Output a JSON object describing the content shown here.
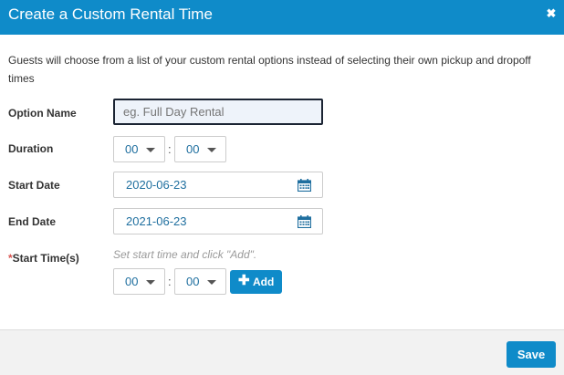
{
  "modal": {
    "title": "Create a Custom Rental Time",
    "close_icon": "close-icon",
    "intro": "Guests will choose from a list of your custom rental options instead of selecting their own pickup and dropoff times"
  },
  "form": {
    "option_name": {
      "label": "Option Name",
      "value": "",
      "placeholder": "eg. Full Day Rental"
    },
    "duration": {
      "label": "Duration",
      "hours": "00",
      "separator": ":",
      "minutes": "00"
    },
    "start_date": {
      "label": "Start Date",
      "value": "2020-06-23",
      "icon": "calendar-icon"
    },
    "end_date": {
      "label": "End Date",
      "value": "2021-06-23",
      "icon": "calendar-icon"
    },
    "start_times": {
      "required_mark": "*",
      "label": "Start Time(s)",
      "hint": "Set start time and click \"Add\".",
      "hours": "00",
      "separator": ":",
      "minutes": "00",
      "add_label": "Add",
      "add_icon": "plus-icon"
    }
  },
  "footer": {
    "save_label": "Save"
  },
  "colors": {
    "accent": "#0f8bc9",
    "required": "#d9534f",
    "value_text": "#1f6f9f"
  }
}
